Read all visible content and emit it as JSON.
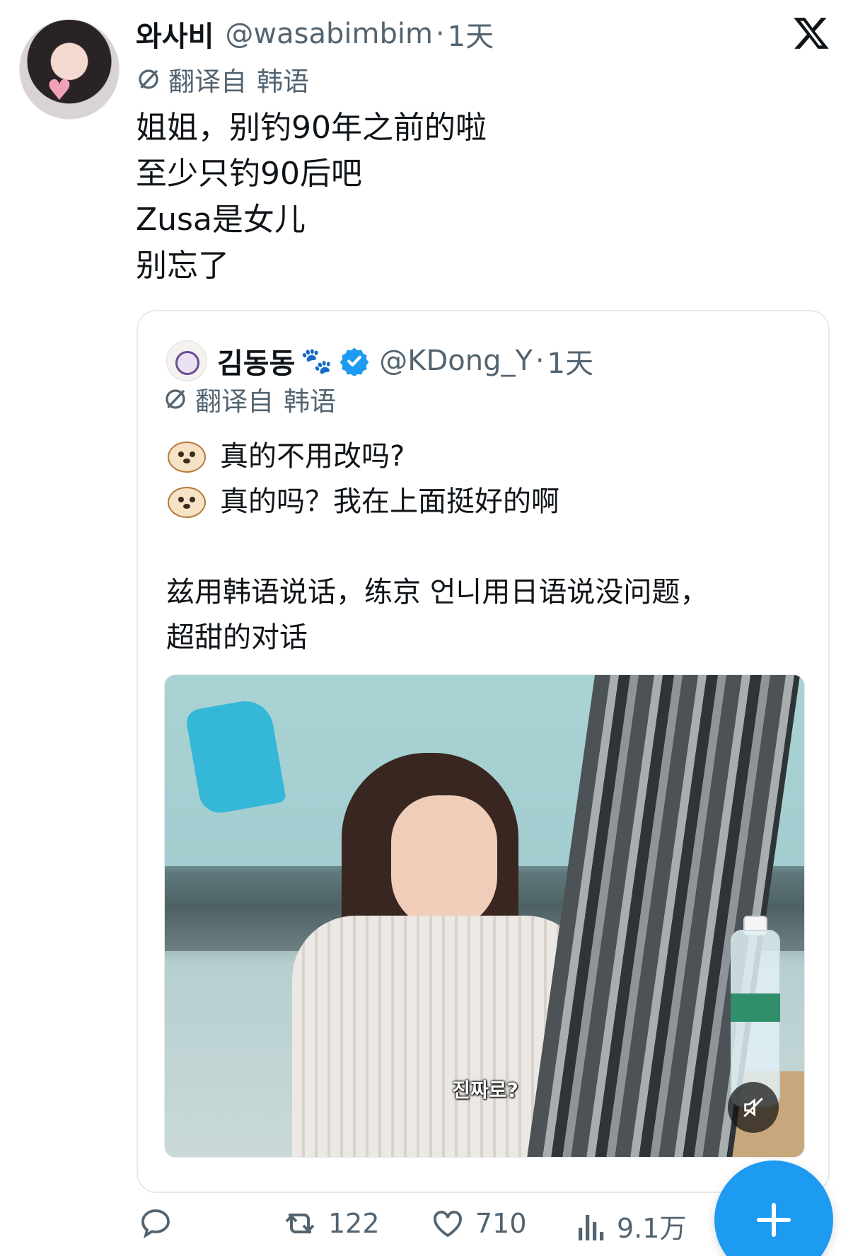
{
  "author": {
    "display_name": "와사비",
    "handle": "@wasabimbim",
    "separator": "·",
    "time": "1天"
  },
  "translation": {
    "prefix": "翻译自",
    "language": "韩语"
  },
  "tweet_lines": [
    "姐姐，别钓90年之前的啦",
    "至少只钓90后吧",
    "Zusa是女儿",
    "别忘了"
  ],
  "quote": {
    "display_name": "김동동",
    "name_emoji": "🐾",
    "handle": "@KDong_Y",
    "separator": "·",
    "time": "1天",
    "translation_prefix": "翻译自",
    "translation_language": "韩语",
    "lines": [
      "真的不用改吗?",
      "真的吗？我在上面挺好的啊"
    ],
    "paragraph": [
      "兹用韩语说话，练京 언니用日语说没问题，",
      "超甜的对话"
    ],
    "media_caption": "진짜로?"
  },
  "actions": {
    "replies": "",
    "retweets": "122",
    "likes": "710",
    "views": "9.1万"
  },
  "colors": {
    "text": "#0f1419",
    "secondary": "#536471",
    "accent": "#1d9bf0",
    "border": "#e6e9ec"
  },
  "icons": [
    "x-logo-icon",
    "translate-icon",
    "verified-badge-icon",
    "dog-face-emoji",
    "mute-icon",
    "reply-icon",
    "retweet-icon",
    "like-icon",
    "views-icon",
    "plus-icon"
  ]
}
